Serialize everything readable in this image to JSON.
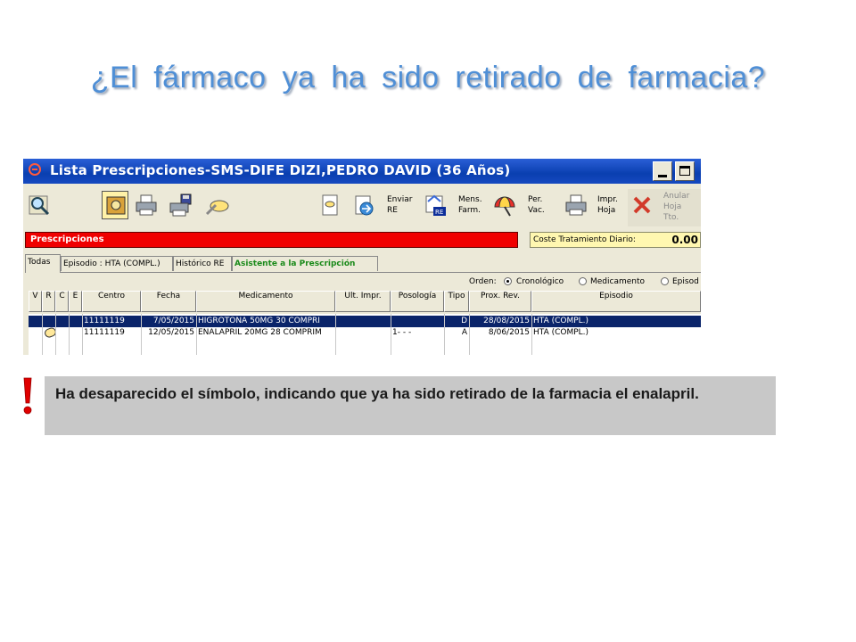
{
  "slide": {
    "title": "¿El fármaco  ya ha  sido  retirado de  farmacia?"
  },
  "window": {
    "title": "Lista Prescripciones-SMS-DIFE DIZI,PEDRO DAVID (36 Años)"
  },
  "toolbar": {
    "enviar_re": "Enviar\nRE",
    "mens_farm": "Mens.\nFarm.",
    "per_vac": "Per.\nVac.",
    "impr_hoja": "Impr.\nHoja",
    "anular_hoja": "Anular\nHoja\nTto."
  },
  "prescripciones": {
    "header": "Prescripciones",
    "cost_label": "Coste Tratamiento Diario:",
    "cost_value": "0.00"
  },
  "tabs": [
    {
      "label": "Todas"
    },
    {
      "label": "Episodio : HTA (COMPL.)"
    },
    {
      "label": "Histórico RE"
    },
    {
      "label": "Asistente a la Prescripción"
    }
  ],
  "order": {
    "label": "Orden:",
    "options": [
      "Cronológico",
      "Medicamento",
      "Episod"
    ],
    "selected": "Cronológico"
  },
  "table": {
    "columns": [
      "V",
      "R",
      "C",
      "E",
      "Centro",
      "Fecha",
      "Medicamento",
      "Ult. Impr.",
      "Posología",
      "Tipo",
      "Prox. Rev.",
      "Episodio"
    ],
    "rows": [
      {
        "centro": "11111119",
        "fecha": "7/05/2015",
        "medicamento": "HIGROTONA 50MG 30 COMPRI",
        "ult_impr": "",
        "posologia": "",
        "tipo": "D",
        "prox_rev": "28/08/2015",
        "episodio": "HTA (COMPL.)",
        "selected": true
      },
      {
        "centro": "11111119",
        "fecha": "12/05/2015",
        "medicamento": "ENALAPRIL 20MG 28 COMPRIM",
        "ult_impr": "",
        "posologia": "1- - -",
        "tipo": "A",
        "prox_rev": "8/06/2015",
        "episodio": "HTA (COMPL.)",
        "selected": false
      }
    ]
  },
  "note": {
    "text": "Ha  desaparecido  el  símbolo, indicando  que ya  ha  sido retirado de la  farmacia el enalapril."
  },
  "colors": {
    "title_blue": "#4f8fd6",
    "titlebar": "#0a3fb0",
    "prescr_red": "#f00000",
    "selected_row": "#0a246a",
    "note_bg": "#c8c8c8",
    "warning_red": "#e00000"
  }
}
